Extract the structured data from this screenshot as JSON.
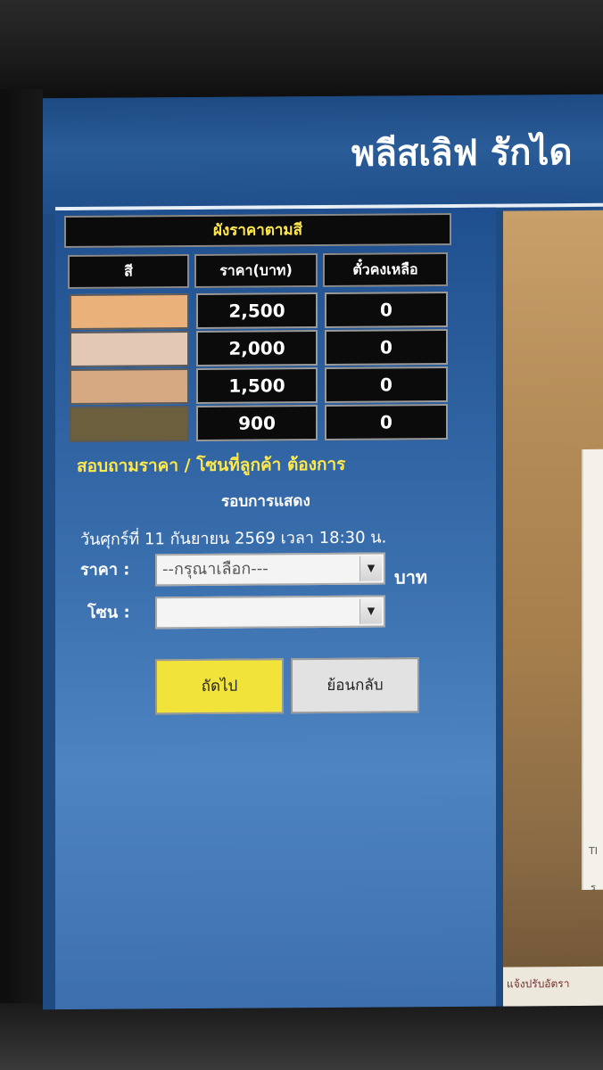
{
  "header": {
    "title": "พลีสเลิฟ รักได"
  },
  "price_chart": {
    "title": "ผังราคาตามสี",
    "columns": [
      "สี",
      "ราคา(บาท)",
      "ตั๋วคงเหลือ"
    ],
    "rows": [
      {
        "color": "#eab27a",
        "price": "2,500",
        "remaining": "0"
      },
      {
        "color": "#e3c8b6",
        "price": "2,000",
        "remaining": "0"
      },
      {
        "color": "#d6a983",
        "price": "1,500",
        "remaining": "0"
      },
      {
        "color": "#6c5f3d",
        "price": "900",
        "remaining": "0"
      }
    ]
  },
  "form": {
    "inquiry_heading": "สอบถามราคา / โซนที่ลูกค้า ต้องการ",
    "show_round_label": "รอบการแสดง",
    "show_date": "วันศุกร์ที่ 11 กันยายน 2569 เวลา 18:30 น.",
    "price_label": "ราคา :",
    "price_select_value": "--กรุณาเลือก---",
    "price_unit": "บาท",
    "zone_label": "โซน :",
    "zone_select_value": "",
    "next_button": "ถัดไป",
    "back_button": "ย้อนกลับ"
  },
  "side_banner": {
    "card_text_1": "TI",
    "card_text_2": "ร",
    "footer_text": "แจ้งปรับอัตรา"
  },
  "colors": {
    "accent_yellow": "#ffe84a",
    "panel_blue": "#1f4b83",
    "next_button": "#f2e33a",
    "back_button": "#e2e2e2"
  }
}
